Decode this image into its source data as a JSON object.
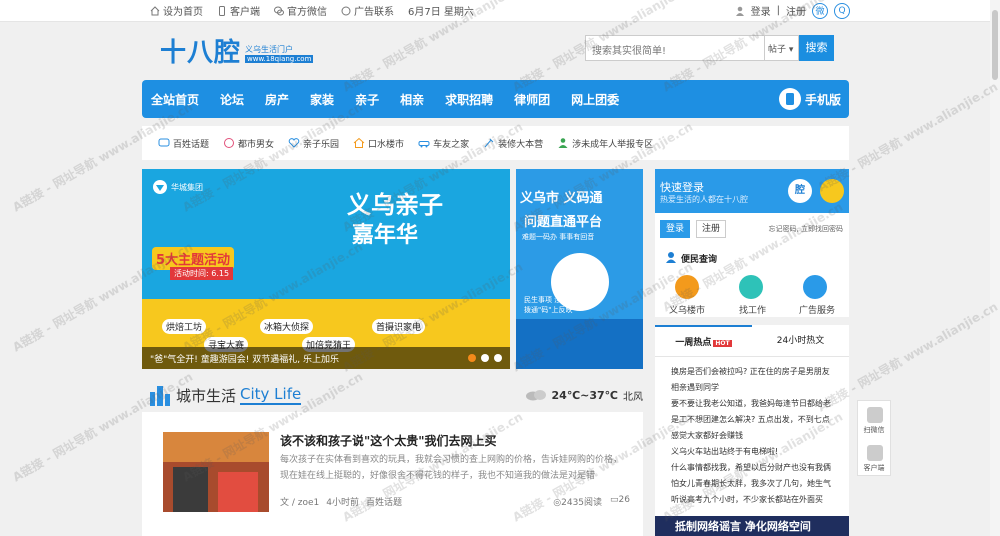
{
  "topbar": {
    "home": "设为首页",
    "client": "客户端",
    "wechat": "官方微信",
    "ad": "广告联系",
    "date": "6月7日 星期六",
    "login": "登录",
    "sep": "|",
    "register": "注册"
  },
  "logo": {
    "big": "十八腔",
    "sub": "义乌生活门户",
    "url": "www.18qiang.com"
  },
  "search": {
    "placeholder": "搜索其实很简单!",
    "type": "帖子",
    "button": "搜索"
  },
  "nav": {
    "items": [
      "全站首页",
      "论坛",
      "房产",
      "家装",
      "亲子",
      "相亲",
      "求职招聘",
      "律师团",
      "网上团委"
    ],
    "mobile": "手机版"
  },
  "subnav": [
    "百姓话题",
    "都市男女",
    "亲子乐园",
    "口水楼市",
    "车友之家",
    "装修大本营",
    "涉未成年人举报专区"
  ],
  "banner": {
    "logo": "华城集团",
    "title": "义乌亲子",
    "title2": "嘉年华",
    "badge": "5大主题活动",
    "date": "活动时间: 6.15",
    "tags": [
      "烘焙工坊",
      "冰箱大侦探",
      "寻宝大赛",
      "加倍竞猜王",
      "首摄识家电"
    ],
    "caption": "\"爸\"气全开! 童趣游园会! 双节遇福礼, 乐上加乐"
  },
  "banner2": {
    "t1": "义乌市 义码通",
    "t2": "问题直通平台",
    "t3": "难题一码办  事事有回音",
    "t4": "民生事项  涉企诉求",
    "t5": "拨通\"码\"上反映"
  },
  "section": {
    "cn": "城市生活",
    "en": "City Life",
    "temp": "24℃~37℃",
    "wind": "北风"
  },
  "article": {
    "title": "该不该和孩子说\"这个太贵\"我们去网上买",
    "summary": "每次孩子在实体看到喜欢的玩具，我就会习惯的查上网购的价格，告诉娃网购的价格，现在娃在线上挺聪的，好像很舍不得花钱的样子，我也不知道我的做法是对是错",
    "author": "文 / zoe1",
    "time": "4小时前",
    "source": "百姓话题",
    "views": "2435阅读",
    "replies": "26"
  },
  "login": {
    "title": "快速登录",
    "sub": "热爱生活的人都在十八腔",
    "avatar": "腔",
    "btn_login": "登录",
    "btn_reg": "注册",
    "forgot": "忘记密码, 立即找回密码"
  },
  "service": {
    "title": "便民查询",
    "items": [
      "义乌楼市",
      "找工作",
      "广告服务"
    ]
  },
  "hot": {
    "tab1": "一周热点",
    "tab1_mark": "HOT",
    "tab2": "24小时热文",
    "items": [
      "换房是否们会被拉吗? 正在住的房子是男朋友",
      "相亲遇到同学",
      "要不要让我老公知道，我爸妈每逢节日都给老",
      "是工不想团建怎么解决? 五点出发，不到七点",
      "感觉大家都好会赚钱",
      "义乌火车站出站终于有电梯啦!",
      "什么事情都找我，希望以后分财产也没有我俩",
      "怕女儿青春期长太胖，我多次了几句，她生气",
      "听说高考九个小时，不少家长都站在外面买"
    ]
  },
  "ad_dark": "抵制网络谣言 净化网络空间",
  "float": {
    "wechat": "扫微信",
    "client": "客户端"
  },
  "watermark": "A链接 - 网址导航 www.alianjie.cn"
}
